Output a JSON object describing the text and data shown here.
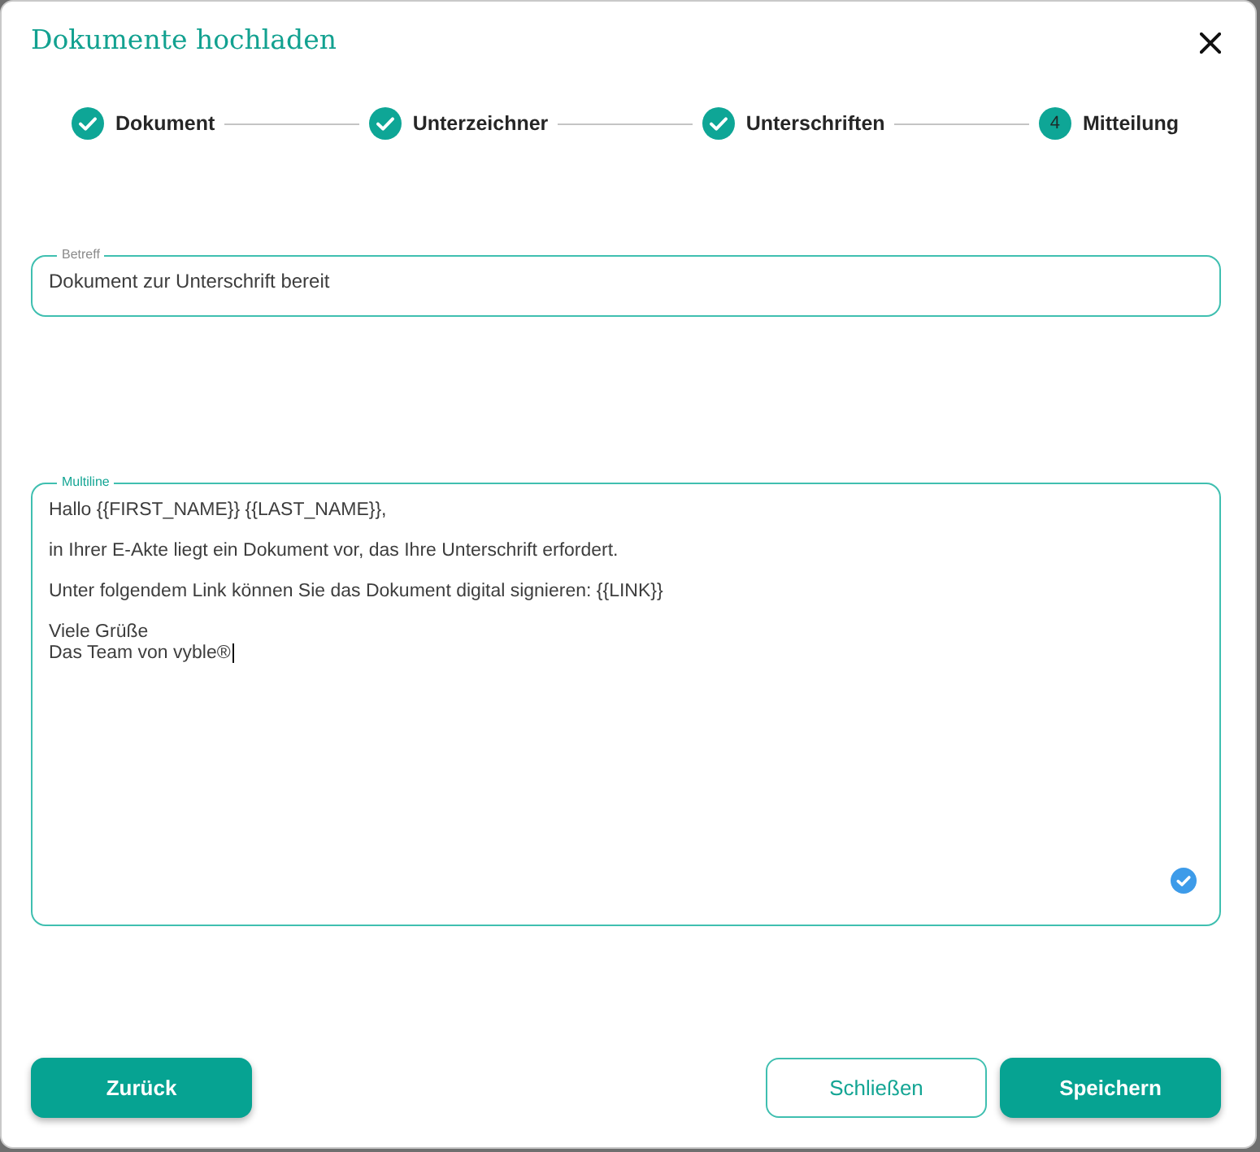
{
  "dialog": {
    "title": "Dokumente hochladen"
  },
  "steps": [
    {
      "label": "Dokument",
      "completed": true
    },
    {
      "label": "Unterzeichner",
      "completed": true
    },
    {
      "label": "Unterschriften",
      "completed": true
    },
    {
      "label": "Mitteilung",
      "completed": false,
      "number": "4"
    }
  ],
  "fields": [
    {
      "kind": "single_line",
      "label": "Betreff",
      "value": "Dokument zur Unterschrift bereit",
      "focused": false
    },
    {
      "kind": "multiline",
      "label": "Multiline",
      "value": "Hallo {{FIRST_NAME}} {{LAST_NAME}},\n\nin Ihrer E-Akte liegt ein Dokument vor, das Ihre Unterschrift erfordert.\n\nUnter folgendem Link können Sie das Dokument digital signieren: {{LINK}}\n\nViele Grüße\nDas Team von vyble®",
      "focused": true
    }
  ],
  "footer": {
    "left_buttons": [
      {
        "label": "Zurück",
        "kind": "primary"
      }
    ],
    "right_buttons": [
      {
        "label": "Schließen",
        "kind": "outline"
      },
      {
        "label": "Speichern",
        "kind": "primary"
      }
    ]
  }
}
